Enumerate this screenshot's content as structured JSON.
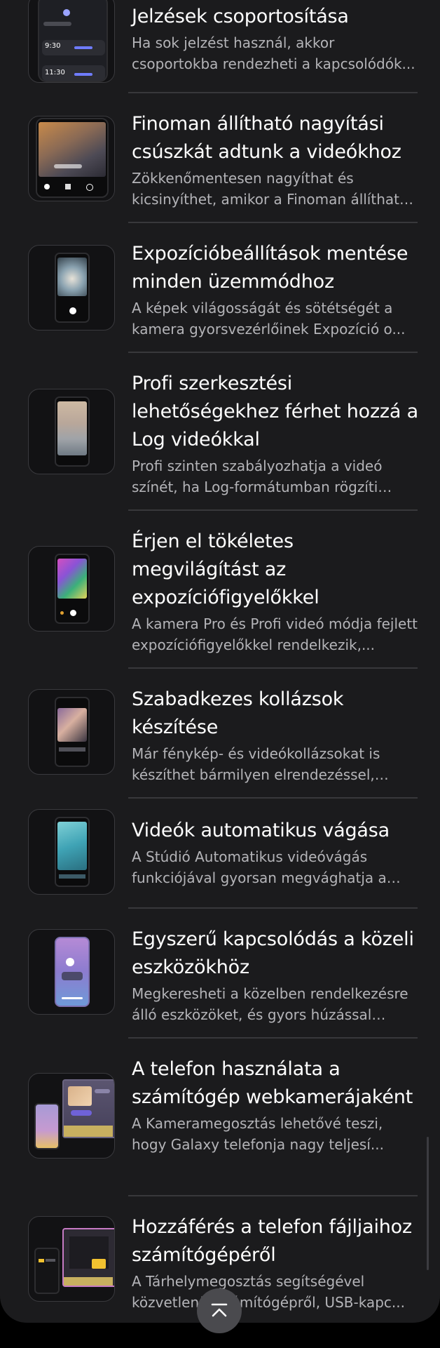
{
  "items": [
    {
      "title": "Jelzések csoportosítása",
      "description": "Ha sok jelzést használ, akkor csoportokba rendezheti a kapcsolódók..."
    },
    {
      "title": "Finoman állítható nagyítási csúszkát adtunk a videókhoz",
      "description": "Zökkenőmentesen nagyíthat és kicsinyíthet, amikor a Finoman állítható ..."
    },
    {
      "title": "Expozícióbeállítások mentése minden üzemmódhoz",
      "description": "A képek világosságát és sötétségét a kamera gyorsvezérlőinek Expozíció o..."
    },
    {
      "title": "Profi szerkesztési lehetőségekhez férhet hozzá a Log videókkal",
      "description": "Profi szinten szabályozhatja a videó színét, ha Log-formátumban rögzíti öke..."
    },
    {
      "title": "Érjen el tökéletes megvilágítást az expozíciófigyelőkkel",
      "description": "A kamera Pro és Profi videó módja fejlett expozíciófigyelőkkel rendelkezik,..."
    },
    {
      "title": "Szabadkezes kollázsok készítése",
      "description": "Már fénykép- és videókollázsokat is készíthet bármilyen elrendezéssel, amit..."
    },
    {
      "title": "Videók automatikus vágása",
      "description": "A Stúdió Automatikus videóvágás funkciójával gyorsan megvághatja a vid..."
    },
    {
      "title": "Egyszerű kapcsolódás a közeli eszközökhöz",
      "description": "Megkeresheti a közelben rendelkezésre álló eszközöket, és gyors húzással kapc..."
    },
    {
      "title": "A telefon használata a számítógép webkamerájaként",
      "description": "A Kameramegosztás lehetővé teszi, hogy Galaxy telefonja nagy teljesí..."
    },
    {
      "title": "Hozzáférés a telefon fájljaihoz számítógépéről",
      "description": "A Tárhelymegosztás segítségével közvetlenül számítógépről, USB-kapc..."
    }
  ],
  "thumb_labels": {
    "time1": "9:30",
    "time2": "11:30"
  },
  "colors": {
    "background": "#1b1b1d",
    "title": "#ffffff",
    "description": "#b4b4b8",
    "divider": "#38383b"
  },
  "scroll_top_button": {
    "icon": "chevron-up-icon"
  }
}
